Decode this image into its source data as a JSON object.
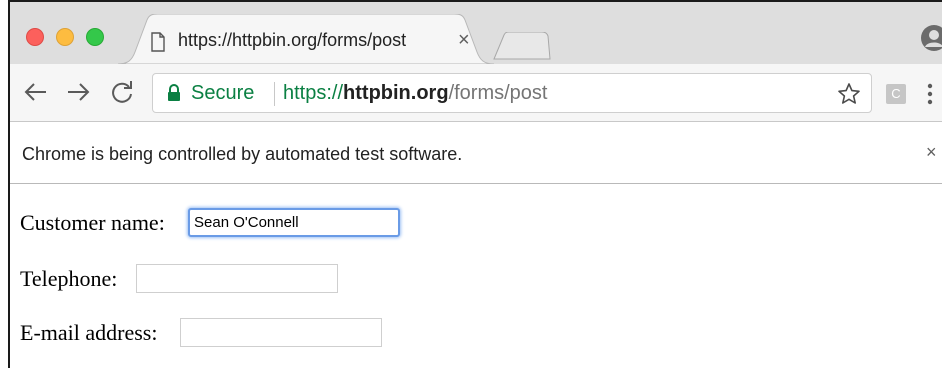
{
  "browser": {
    "tab": {
      "title": "https://httpbin.org/forms/post",
      "close_glyph": "×",
      "page_icon": "document-icon"
    },
    "profile_icon": "person-icon",
    "nav": {
      "back_icon": "arrow-left-icon",
      "forward_icon": "arrow-right-icon",
      "reload_icon": "reload-icon"
    },
    "omnibox": {
      "security_label": "Secure",
      "url_scheme": "https://",
      "url_host": "httpbin.org",
      "url_path": "/forms/post",
      "lock_icon": "lock-icon",
      "bookmark_icon": "star-icon"
    },
    "extension_label": "C",
    "menu_icon": "vertical-dots-icon",
    "colors": {
      "secure_green": "#0b8043",
      "focus_blue": "#6a9be6",
      "close_red": "#fc605c",
      "minimize_yellow": "#fdbc40",
      "zoom_green": "#34c84a"
    }
  },
  "infobar": {
    "message": "Chrome is being controlled by automated test software.",
    "close_glyph": "×"
  },
  "form": {
    "fields": [
      {
        "label": "Customer name:",
        "value": "Sean O'Connell",
        "focused": true
      },
      {
        "label": "Telephone:",
        "value": ""
      },
      {
        "label": "E-mail address:",
        "value": ""
      }
    ]
  }
}
